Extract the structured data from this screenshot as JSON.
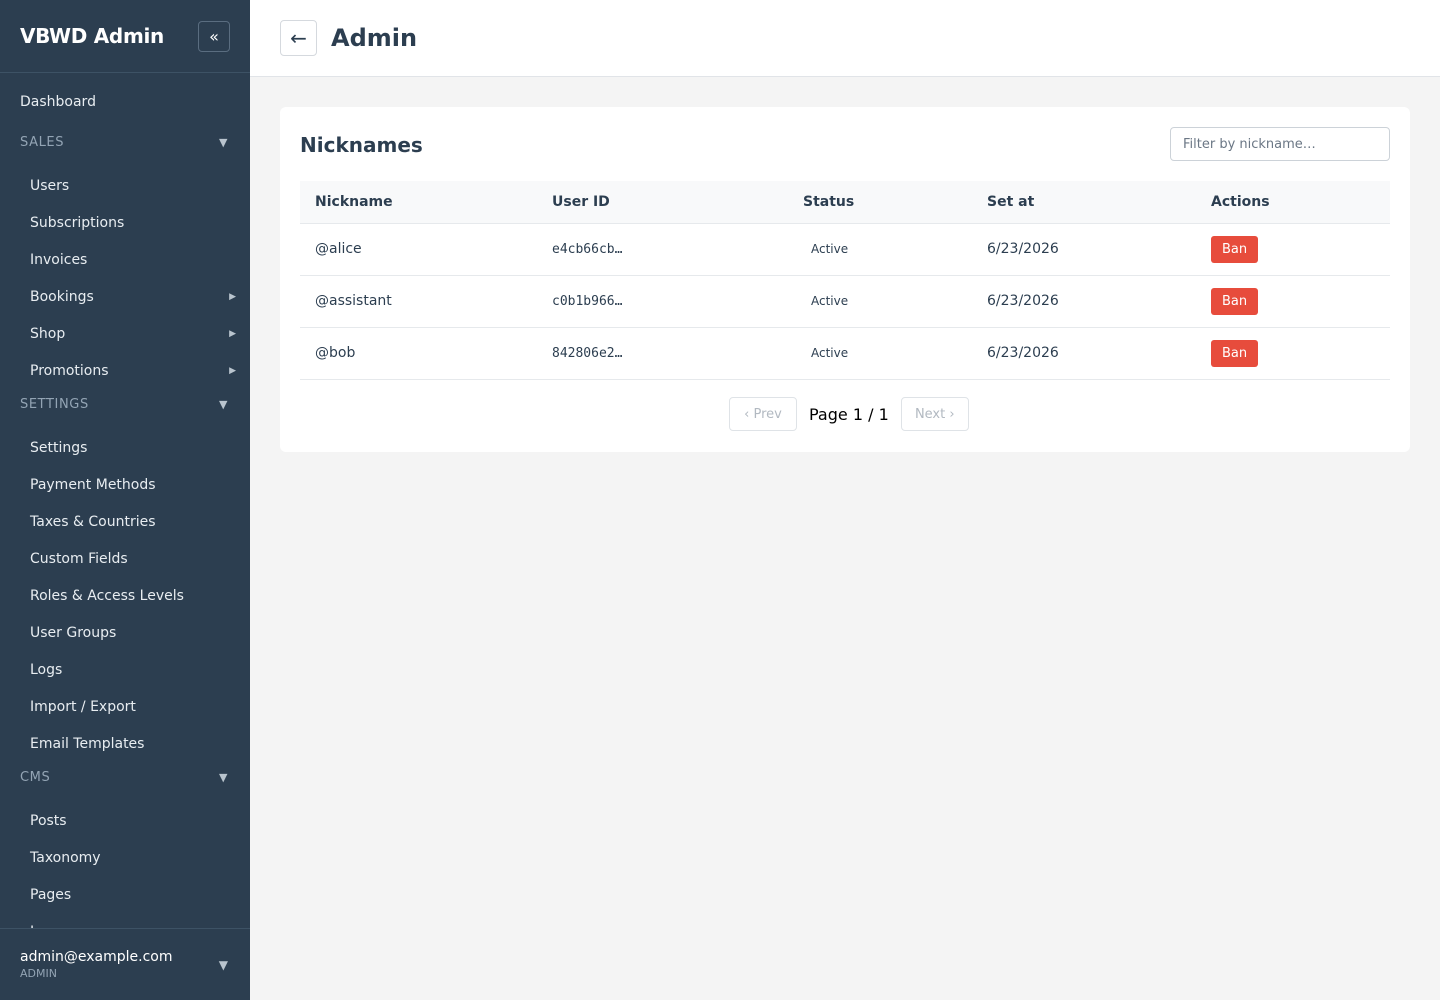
{
  "sidebar": {
    "brand": "VBWD Admin",
    "collapse_label": "«",
    "top_items": [
      {
        "label": "Dashboard"
      }
    ],
    "sections": [
      {
        "title": "SALES",
        "items": [
          {
            "label": "Users"
          },
          {
            "label": "Subscriptions"
          },
          {
            "label": "Invoices"
          },
          {
            "label": "Bookings",
            "has_submenu": true
          },
          {
            "label": "Shop",
            "has_submenu": true
          },
          {
            "label": "Promotions",
            "has_submenu": true
          }
        ]
      },
      {
        "title": "SETTINGS",
        "items": [
          {
            "label": "Settings"
          },
          {
            "label": "Payment Methods"
          },
          {
            "label": "Taxes & Countries"
          },
          {
            "label": "Custom Fields"
          },
          {
            "label": "Roles & Access Levels"
          },
          {
            "label": "User Groups"
          },
          {
            "label": "Logs"
          },
          {
            "label": "Import / Export"
          },
          {
            "label": "Email Templates"
          }
        ]
      },
      {
        "title": "CMS",
        "items": [
          {
            "label": "Posts"
          },
          {
            "label": "Taxonomy"
          },
          {
            "label": "Pages"
          },
          {
            "label": "Images"
          }
        ]
      }
    ],
    "user": {
      "email": "admin@example.com",
      "role": "ADMIN"
    }
  },
  "header": {
    "back_label": "←",
    "title": "Admin"
  },
  "card": {
    "title": "Nicknames",
    "filter_placeholder": "Filter by nickname…",
    "filter_value": "",
    "columns": [
      "Nickname",
      "User ID",
      "Status",
      "Set at",
      "Actions"
    ],
    "rows": [
      {
        "nickname": "@alice",
        "user_id": "e4cb66cb…",
        "status": "Active",
        "set_at": "6/23/2026",
        "action": "Ban"
      },
      {
        "nickname": "@assistant",
        "user_id": "c0b1b966…",
        "status": "Active",
        "set_at": "6/23/2026",
        "action": "Ban"
      },
      {
        "nickname": "@bob",
        "user_id": "842806e2…",
        "status": "Active",
        "set_at": "6/23/2026",
        "action": "Ban"
      }
    ],
    "pagination": {
      "prev_label": "‹ Prev",
      "page_label": "Page 1 / 1",
      "next_label": "Next ›"
    }
  },
  "colors": {
    "sidebar_bg": "#2c3e50",
    "accent_danger": "#e74c3c",
    "page_bg": "#f4f4f4"
  }
}
